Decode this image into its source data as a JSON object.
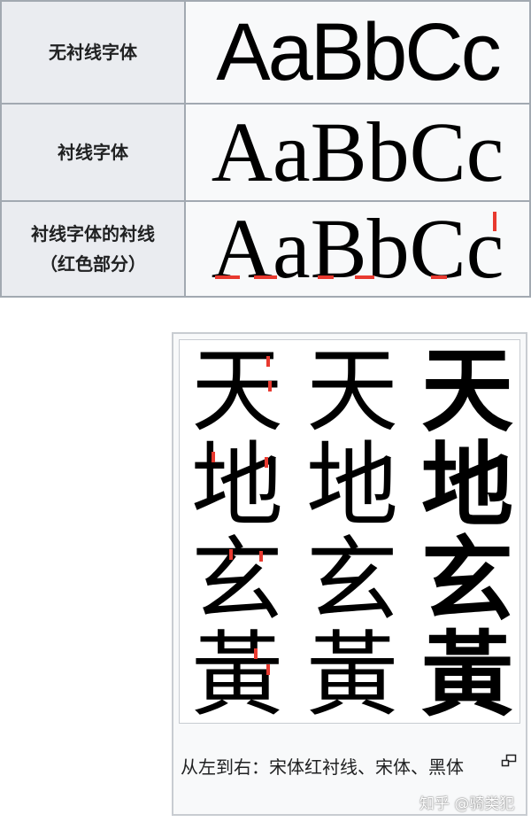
{
  "table": {
    "rows": [
      {
        "label": "无衬线字体",
        "sample": "AaBbCc"
      },
      {
        "label": "衬线字体",
        "sample": "AaBbCc"
      },
      {
        "label": "衬线字体的衬线（红色部分）",
        "label_line1": "衬线字体的衬线",
        "label_line2": "（红色部分）",
        "sample": "AaBbCc"
      }
    ]
  },
  "figure": {
    "characters": [
      "天",
      "地",
      "玄",
      "黃"
    ],
    "columns": [
      "宋体红衬线",
      "宋体",
      "黑体"
    ],
    "caption": "从左到右：宋体红衬线、宋体、黑体",
    "highlight_color": "#e8392f"
  },
  "watermark": "知乎 @骑类犯"
}
